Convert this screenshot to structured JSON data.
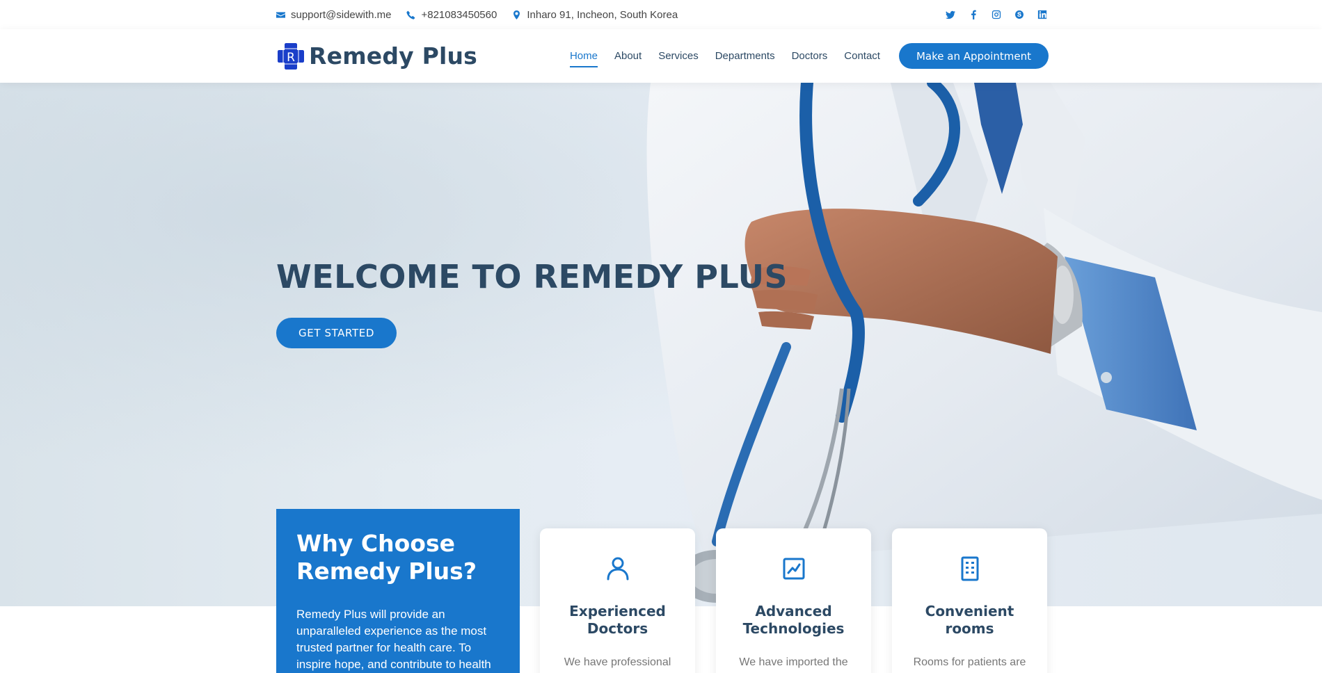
{
  "topbar": {
    "email": "support@sidewith.me",
    "phone": "+821083450560",
    "address": "Inharo 91, Incheon, South Korea",
    "socials": [
      "twitter-icon",
      "facebook-icon",
      "instagram-icon",
      "skype-icon",
      "linkedin-icon"
    ]
  },
  "header": {
    "logo_text": "Remedy Plus",
    "logo_letter": "R",
    "nav": [
      "Home",
      "About",
      "Services",
      "Departments",
      "Doctors",
      "Contact"
    ],
    "active_nav": "Home",
    "appointment_label": "Make an Appointment"
  },
  "hero": {
    "title": "WELCOME TO REMEDY PLUS",
    "cta_label": "GET STARTED"
  },
  "why": {
    "title": "Why Choose Remedy Plus?",
    "text": "Remedy Plus will provide an unparalleled experience as the most trusted partner for health care. To inspire hope, and contribute to health"
  },
  "features": [
    {
      "icon": "person-icon",
      "title": "Experienced Doctors",
      "text": "We have professional"
    },
    {
      "icon": "chart-icon",
      "title": "Advanced Technologies",
      "text": "We have imported the"
    },
    {
      "icon": "building-icon",
      "title": "Convenient rooms",
      "text": "Rooms for patients are"
    }
  ],
  "colors": {
    "accent": "#1977cc",
    "heading": "#2c4964",
    "logo_blue": "#1a3ec9"
  }
}
